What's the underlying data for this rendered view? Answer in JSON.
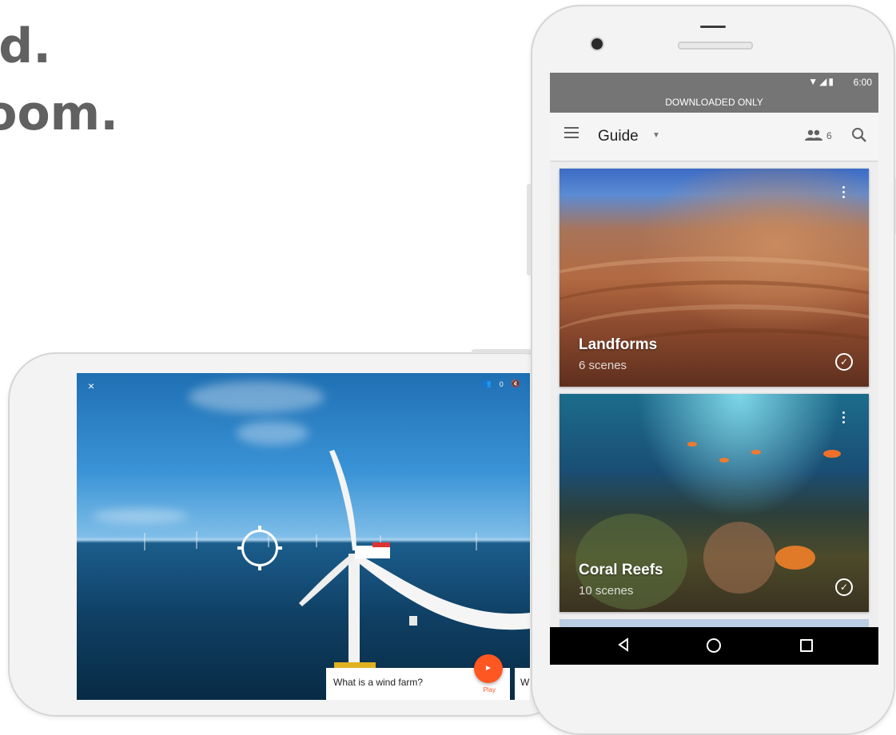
{
  "headline": {
    "line1": "ld.",
    "line2": "oom."
  },
  "landscape": {
    "close_icon": "×",
    "people_count": "0",
    "card_question": "What is a wind farm?",
    "play_label": "Play",
    "next_card_peek": "Wh"
  },
  "portrait": {
    "status_time": "6:00",
    "banner": "DOWNLOADED ONLY",
    "title": "Guide",
    "participants": "6",
    "cards": [
      {
        "name": "Landforms",
        "scenes": "6 scenes"
      },
      {
        "name": "Coral Reefs",
        "scenes": "10 scenes"
      }
    ]
  },
  "colors": {
    "accent": "#ff5722",
    "status_bar": "#757575"
  }
}
